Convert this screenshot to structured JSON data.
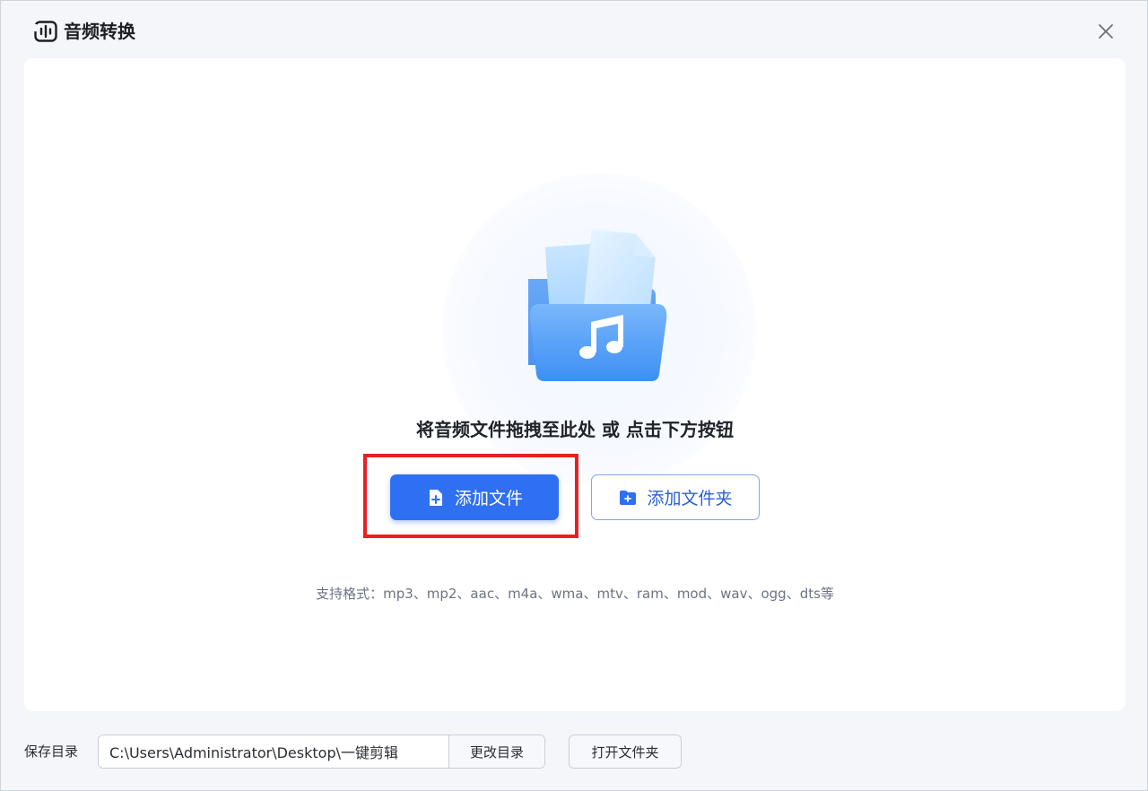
{
  "app": {
    "title": "音频转换",
    "icon": "audio-wave-icon",
    "close_icon": "close-icon"
  },
  "dropzone": {
    "illustration_icon": "music-folder-icon",
    "hint": "将音频文件拖拽至此处 或 点击下方按钮",
    "add_file_label": "添加文件",
    "add_file_icon": "file-plus-icon",
    "add_folder_label": "添加文件夹",
    "add_folder_icon": "folder-plus-icon",
    "formats": "支持格式：mp3、mp2、aac、m4a、wma、mtv、ram、mod、wav、ogg、dts等"
  },
  "footer": {
    "save_dir_label": "保存目录",
    "save_dir_value": "C:\\Users\\Administrator\\Desktop\\一键剪辑",
    "change_dir_label": "更改目录",
    "open_folder_label": "打开文件夹"
  },
  "colors": {
    "primary": "#2f6ff2",
    "highlight": "#ea1f1f",
    "panel_bg": "#ffffff",
    "window_bg": "#f4f6fa"
  }
}
